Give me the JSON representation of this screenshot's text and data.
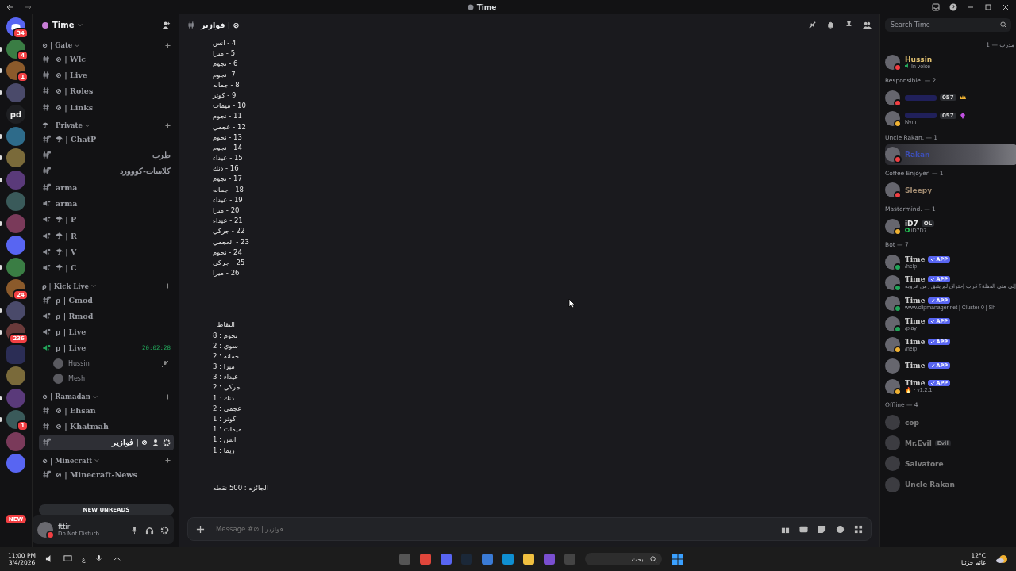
{
  "window": {
    "title": "Time"
  },
  "servers": [
    {
      "kind": "home",
      "badge": "34",
      "unread": false
    },
    {
      "kind": "image",
      "badge": "4",
      "unread": true
    },
    {
      "kind": "image",
      "badge": "1",
      "unread": true
    },
    {
      "kind": "image",
      "unread": true
    },
    {
      "kind": "text",
      "label": "pd",
      "unread": false
    },
    {
      "kind": "image",
      "unread": true
    },
    {
      "kind": "image",
      "unread": true
    },
    {
      "kind": "image",
      "unread": true
    },
    {
      "kind": "image",
      "unread": false
    },
    {
      "kind": "image",
      "unread": true
    },
    {
      "kind": "image",
      "unread": false
    },
    {
      "kind": "image",
      "unread": true
    },
    {
      "kind": "image",
      "badge": "24",
      "unread": false
    },
    {
      "kind": "image",
      "unread": true
    },
    {
      "kind": "image",
      "badge": "236",
      "unread": true
    },
    {
      "kind": "folder",
      "unread": false
    },
    {
      "kind": "image",
      "unread": false
    },
    {
      "kind": "image",
      "unread": true
    },
    {
      "kind": "image",
      "badge": "1",
      "unread": true
    },
    {
      "kind": "image",
      "unread": false
    },
    {
      "kind": "image",
      "unread": false
    }
  ],
  "new_pill": "NEW",
  "sidebar": {
    "server_name": "Time",
    "categories": [
      {
        "name": "⊘ | Gate",
        "channels": [
          {
            "kind": "text",
            "name": "⊘ | Wlc",
            "selected": false
          },
          {
            "kind": "text",
            "name": "⊘ | Live",
            "selected": false
          },
          {
            "kind": "text",
            "name": "⊘ | Roles",
            "selected": false
          },
          {
            "kind": "text",
            "name": "⊘ | Links",
            "selected": false
          }
        ]
      },
      {
        "name": "☂ | Private",
        "channels": [
          {
            "kind": "text-locked",
            "name": "☂ | ChatP",
            "selected": false
          },
          {
            "kind": "text-locked",
            "name": "طرب",
            "selected": false
          },
          {
            "kind": "text-locked",
            "name": "كلاسات-كووورد",
            "selected": false
          },
          {
            "kind": "text-locked",
            "name": "arma",
            "selected": false
          },
          {
            "kind": "voice-locked",
            "name": "arma",
            "selected": false
          },
          {
            "kind": "voice-locked",
            "name": "☂ | P",
            "selected": false
          },
          {
            "kind": "voice-locked",
            "name": "☂ | R",
            "selected": false
          },
          {
            "kind": "voice-locked",
            "name": "☂ | V",
            "selected": false
          },
          {
            "kind": "voice-locked",
            "name": "☂ | C",
            "selected": false
          }
        ]
      },
      {
        "name": "ρ | Kick Live",
        "channels": [
          {
            "kind": "text-locked",
            "name": "ρ | Cmod",
            "selected": false
          },
          {
            "kind": "voice-locked",
            "name": "ρ | Rmod",
            "selected": false
          },
          {
            "kind": "voice-locked",
            "name": "ρ | Live",
            "selected": false
          },
          {
            "kind": "voice-locked",
            "name": "ρ | Live",
            "selected": false,
            "connected": true,
            "timer": "20:02:28",
            "users": [
              {
                "name": "Hussin",
                "muted": true
              },
              {
                "name": "Mesh",
                "muted": false
              }
            ]
          }
        ]
      },
      {
        "name": "⊘ | Ramadan",
        "channels": [
          {
            "kind": "text",
            "name": "⊘ | Ehsan",
            "selected": false
          },
          {
            "kind": "text",
            "name": "⊘ | Khatmah",
            "selected": false
          },
          {
            "kind": "text-locked",
            "name": "⊘ | فوازير",
            "selected": true
          }
        ]
      },
      {
        "name": "⊘ | Minecraft",
        "channels": [
          {
            "kind": "text-locked",
            "name": "⊘ | Minecraft-News",
            "selected": false
          }
        ]
      }
    ],
    "new_unreads": "NEW UNREADS",
    "user": {
      "name": "fttir",
      "status_text": "Do Not Disturb",
      "color": "#f23f43"
    }
  },
  "channel": {
    "name": "⊘ | فوازير"
  },
  "messages": {
    "list": [
      "4 - انس",
      "5 - ميرا",
      "6 - نجوم",
      "7- نجوم",
      "8 - جمانه",
      "9 - كوثر",
      "10 - ميمات",
      "11 - نجوم",
      "12 - عجمي",
      "13 - نجوم",
      "14 - نجوم",
      "15 - عيداء",
      "16 - دنك",
      "17 - نجوم",
      "18 - جمانه",
      "19 - عيداء",
      "20 - ميرا",
      "21 - عيداء",
      "22 - جركي",
      "23 - العجمي",
      "24 - نجوم",
      "25 - جركي",
      "26 - ميرا"
    ],
    "totals_title": "النقاط :",
    "totals": [
      "نجوم : 8",
      "سوي : 2",
      "جمانه : 2",
      "ميرا : 3",
      "عيداء : 3",
      "جركي : 2",
      "دنك : 1",
      "عجمي : 2",
      "كوثر : 1",
      "ميمات : 1",
      "انس : 1",
      "ريما : 1"
    ],
    "prize": "الجائزه : 500 نقطه"
  },
  "composer": {
    "placeholder": "Message #⊘ | فوازير"
  },
  "search": {
    "placeholder": "Search Time"
  },
  "members": {
    "groups": [
      {
        "title": "مدرب — 1",
        "members": [
          {
            "name": "Hussin",
            "role": {
              "color": "#e0c070"
            },
            "color": "#f23f43",
            "sub": "In voice",
            "voice": true
          }
        ]
      },
      {
        "title": "Responsible. — 2",
        "members": [
          {
            "blurred": true,
            "color": "#f23f43",
            "tag": "057",
            "crown": true
          },
          {
            "blurred": true,
            "color": "#f0b232",
            "tag": "057",
            "gem": true,
            "sub": "Nvm"
          }
        ]
      },
      {
        "title": "Uncle Rakan. — 1",
        "members": [
          {
            "name": "Rakan",
            "role": {
              "color": "#3d4fb8"
            },
            "color": "#f23f43",
            "banner": true
          }
        ]
      },
      {
        "title": "Coffee Enjoyer. — 1",
        "members": [
          {
            "name": "Sleepy",
            "role": {
              "color": "#a08a70"
            },
            "color": "#f23f43"
          }
        ]
      },
      {
        "title": "Mastermind. — 1",
        "members": [
          {
            "name": "iD7",
            "color": "#f0b232",
            "tag": "OL",
            "sub": "iD7D7",
            "ring": true
          }
        ]
      },
      {
        "title": "Bot — 7",
        "members": [
          {
            "name": "Time",
            "color": "#23a55a",
            "app": "APP",
            "sub": "/help"
          },
          {
            "name": "Time",
            "color": "#23a55a",
            "app": "APP",
            "sub": "إلى متى الغفلة؟ قرب إحتراق لم يتبق زمن عروبه"
          },
          {
            "name": "Time",
            "color": "#23a55a",
            "app": "APP",
            "sub": "www.clipmanager.net | Cluster 0 | Sh"
          },
          {
            "name": "Time",
            "color": "#23a55a",
            "app": "APP",
            "sub": "/play"
          },
          {
            "name": "Time",
            "color": "#f0b232",
            "app": "APP",
            "sub": "/help"
          },
          {
            "name": "Time",
            "app": "APP"
          },
          {
            "name": "Time",
            "color": "#f0b232",
            "app": "APP",
            "sub": "🔥 · v1.2.1"
          }
        ]
      },
      {
        "title": "Offline — 4",
        "members": [
          {
            "name": "cop",
            "offline": true
          },
          {
            "name": "Mr.Evil",
            "offline": true,
            "tag": "Evil"
          },
          {
            "name": "Salvatore",
            "offline": true
          },
          {
            "name": "Uncle Rakan",
            "offline": true
          }
        ]
      }
    ]
  },
  "taskbar": {
    "time": "11:00 PM",
    "date": "3/4/2026",
    "language": "ع",
    "search_placeholder": "بحث",
    "temperature": "12°C",
    "weather": "غائم جزئيا"
  }
}
